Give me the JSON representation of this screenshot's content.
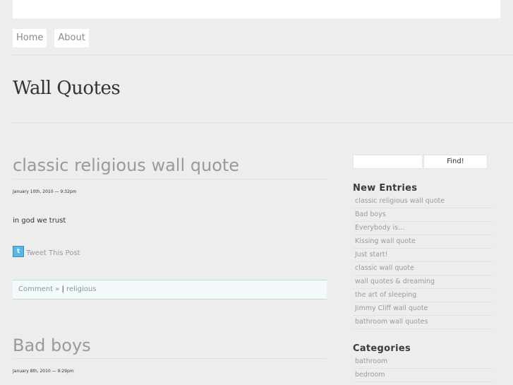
{
  "nav": {
    "items": [
      "Home",
      "About"
    ]
  },
  "site": {
    "title": "Wall Quotes"
  },
  "posts": [
    {
      "title": "classic religious wall quote",
      "date": "January 10th, 2010 — 9:32pm",
      "body": "in god we trust",
      "tweet_label": "Tweet This Post",
      "comment_label": "Comment »",
      "separator": "|",
      "category": "religious"
    },
    {
      "title": "Bad boys",
      "date": "January 8th, 2010 — 9:29pm"
    }
  ],
  "sidebar": {
    "search_button": "Find!",
    "new_entries_heading": "New Entries",
    "new_entries": [
      "classic religious wall quote",
      "Bad boys",
      "Everybody is…",
      "Kissing wall quote",
      "Just start!",
      "classic wall quote",
      "wall quotes & dreaming",
      "the art of sleeping",
      "Jimmy Cliff wall quote",
      "bathroom wall quotes"
    ],
    "categories_heading": "Categories",
    "categories": [
      "bathroom",
      "bedroom"
    ]
  },
  "colors": {
    "background": "#ededed",
    "accent_rule": "#dde8ee",
    "link_gray": "#9a9a9a"
  },
  "icons": {
    "tweet": "twitter-bird-icon"
  }
}
